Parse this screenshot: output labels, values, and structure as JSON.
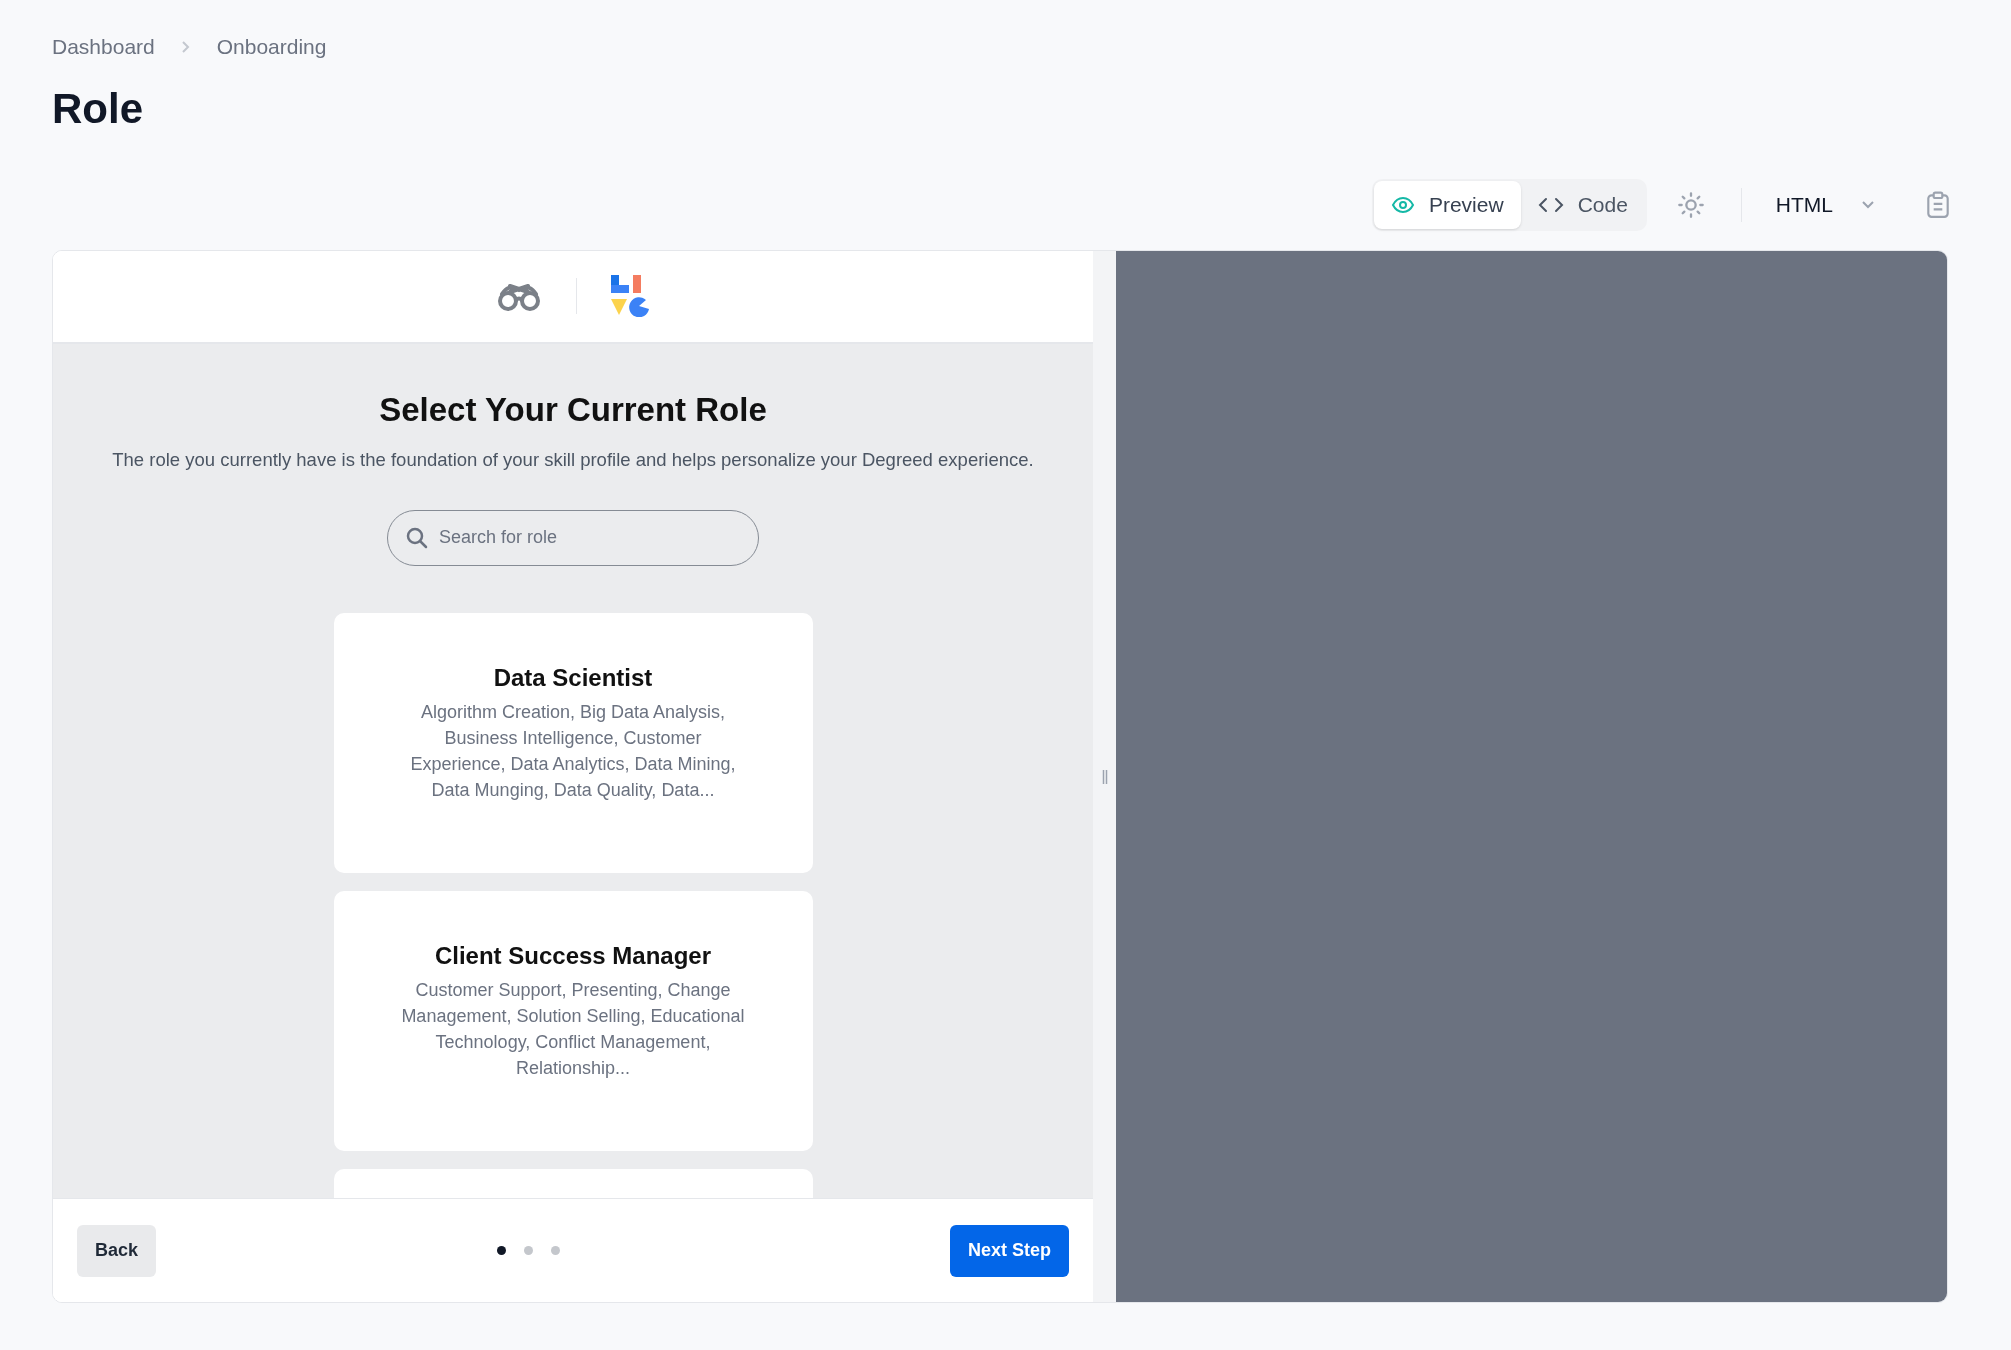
{
  "breadcrumbs": [
    "Dashboard",
    "Onboarding"
  ],
  "title": "Role",
  "toolbar": {
    "view_tabs": [
      {
        "label": "Preview",
        "kind": "preview",
        "selected": true
      },
      {
        "label": "Code",
        "kind": "code",
        "selected": false
      }
    ],
    "language": "HTML"
  },
  "onboarding": {
    "heading": "Select Your Current Role",
    "description": "The role you currently have is the foundation of your skill profile and helps personalize your Degreed experience.",
    "search": {
      "placeholder": "Search for role"
    },
    "roles": [
      {
        "title": "Data Scientist",
        "skills": "Algorithm Creation, Big Data Analysis, Business Intelligence, Customer Experience, Data Analytics, Data Mining, Data Munging, Data Quality, Data..."
      },
      {
        "title": "Client Success Manager",
        "skills": "Customer Support, Presenting, Change Management, Solution Selling, Educational Technology, Conflict Management, Relationship..."
      }
    ],
    "back": "Back",
    "steps": [
      {
        "selected": true
      },
      {
        "selected": false
      },
      {
        "selected": false
      }
    ],
    "next": "Next Step"
  }
}
